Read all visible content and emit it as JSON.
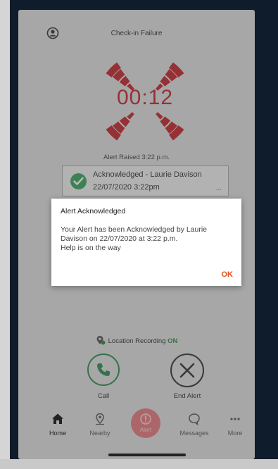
{
  "screen": {
    "title": "Check-in Failure",
    "timer": "00:12",
    "alert_raised": "Alert Raised 3:22 p.m."
  },
  "acknowledgement_card": {
    "name": "Acknowledged - Laurie Davison",
    "date": "22/07/2020 3:22pm",
    "more": "..."
  },
  "dialog": {
    "title": "Alert Acknowledged",
    "body_lines": [
      "Your Alert has been Acknowledged by Laurie",
      "Davison on 22/07/2020 at 3:22 p.m.",
      "Help is on the way"
    ],
    "ok_label": "OK"
  },
  "location": {
    "label": "Location Recording",
    "status": "ON"
  },
  "actions": {
    "call_label": "Call",
    "end_alert_label": "End Alert"
  },
  "tabbar": {
    "home": "Home",
    "nearby": "Nearby",
    "alert": "Alert",
    "messages": "Messages",
    "more": "More"
  },
  "colors": {
    "alarm_red": "#c0272d",
    "acknowledged_green": "#3aa25c",
    "ok_orange": "#e0521f",
    "frame_navy": "#0f1c2b"
  },
  "icons": {
    "profile": "user-circle-icon",
    "alarm": "alarm-waves-icon",
    "check": "check-circle-icon",
    "location": "location-pin-icon",
    "call": "phone-icon",
    "end": "close-x-icon",
    "home": "home-icon",
    "nearby": "map-pin-icon",
    "alert": "alert-icon",
    "messages": "chat-bubble-icon",
    "more": "ellipsis-icon"
  }
}
